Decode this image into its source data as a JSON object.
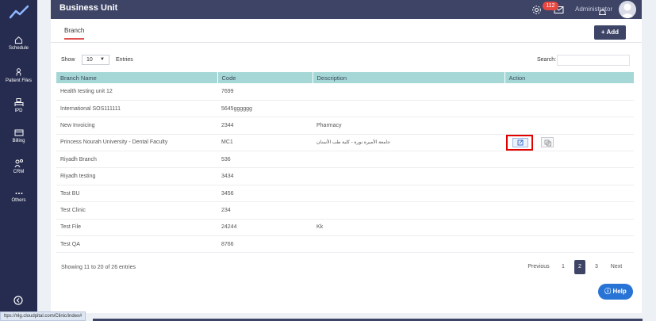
{
  "header": {
    "title": "Business Unit",
    "notification_count": "112",
    "user_name": "Administrator"
  },
  "sidebar": {
    "items": [
      {
        "label": "Schedule",
        "icon": "home-icon"
      },
      {
        "label": "Patient Files",
        "icon": "person-icon"
      },
      {
        "label": "IPD",
        "icon": "bed-icon"
      },
      {
        "label": "Billing",
        "icon": "billing-icon"
      },
      {
        "label": "CRM",
        "icon": "crm-icon"
      },
      {
        "label": "Others",
        "icon": "more-icon"
      }
    ]
  },
  "tabs": [
    {
      "label": "Branch"
    }
  ],
  "toolbar": {
    "add_label": "Add"
  },
  "table_controls": {
    "show_label": "Show",
    "page_size": "10",
    "entries_label": "Entries",
    "search_label": "Search:"
  },
  "table": {
    "columns": [
      "Branch Name",
      "Code",
      "Description",
      "Action"
    ],
    "rows": [
      {
        "name": "Health testing unit 12",
        "code": "7699",
        "description": ""
      },
      {
        "name": "International SOS111111",
        "code": "5645gggggg",
        "description": ""
      },
      {
        "name": "New Invoicing",
        "code": "2344",
        "description": "Pharmacy"
      },
      {
        "name": "Princess Nourah University - Dental Faculty",
        "code": "MC1",
        "description": "جامعة الأميرة نورة - كلية طب الأسنان"
      },
      {
        "name": "Riyadh Branch",
        "code": "536",
        "description": ""
      },
      {
        "name": "Riyadh testing",
        "code": "3434",
        "description": ""
      },
      {
        "name": "Test BU",
        "code": "3456",
        "description": ""
      },
      {
        "name": "Test Clinic",
        "code": "234",
        "description": ""
      },
      {
        "name": "Test File",
        "code": "24244",
        "description": "Kk"
      },
      {
        "name": "Test QA",
        "code": "8766",
        "description": ""
      }
    ]
  },
  "footer": {
    "info": "Showing 11 to 20 of 26 entries",
    "previous": "Previous",
    "pages": [
      "1",
      "2",
      "3"
    ],
    "active_page": "2",
    "next": "Next"
  },
  "help": {
    "label": "Help"
  },
  "status_url": "ttps://nlg.cloudpital.com/Clinic/index#",
  "colors": {
    "sidebar": "#252c4f",
    "header": "#3d4466",
    "table_header": "#a5d7d7",
    "highlight": "#e00000",
    "help": "#2874d6",
    "badge": "#e8473f"
  }
}
